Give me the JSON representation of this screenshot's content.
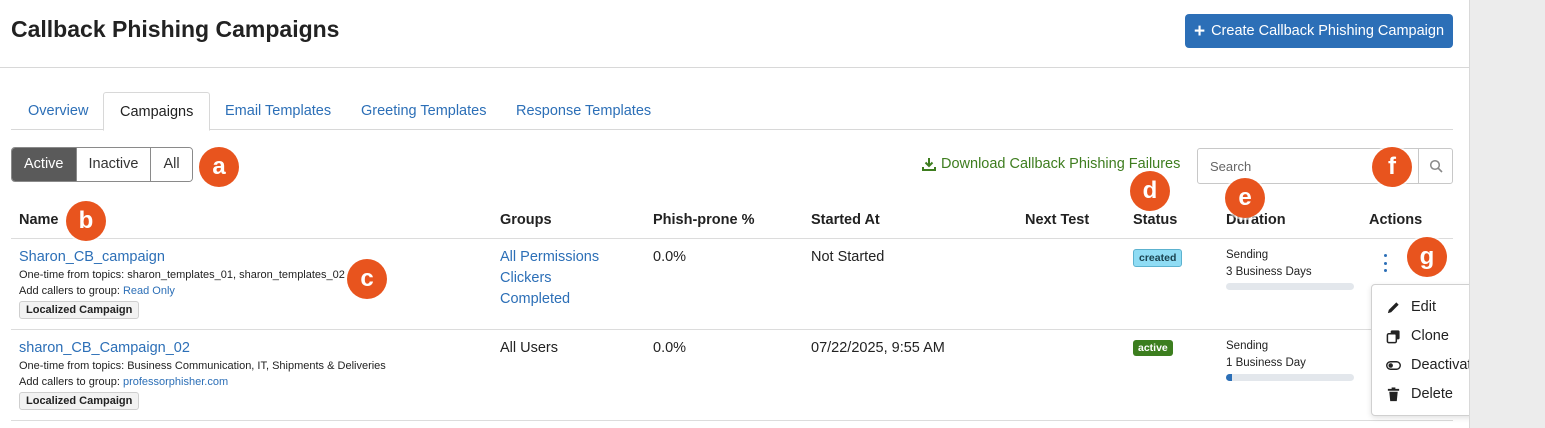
{
  "header": {
    "title": "Callback Phishing Campaigns",
    "create_button": "Create Callback Phishing Campaign"
  },
  "tabs": [
    "Overview",
    "Campaigns",
    "Email Templates",
    "Greeting Templates",
    "Response Templates"
  ],
  "filter": {
    "options": [
      "Active",
      "Inactive",
      "All"
    ],
    "selected": "Active"
  },
  "download_link": "Download Callback Phishing Failures",
  "search": {
    "placeholder": "Search"
  },
  "table": {
    "columns": [
      "Name",
      "Groups",
      "Phish-prone %",
      "Started At",
      "Next Test",
      "Status",
      "Duration",
      "Actions"
    ],
    "rows": [
      {
        "name": "Sharon_CB_campaign",
        "topics": "One-time from topics: sharon_templates_01, sharon_templates_02",
        "callers_prefix": "Add callers to group: ",
        "callers_group": "Read Only",
        "tag": "Localized Campaign",
        "groups": [
          "All Permissions",
          "Clickers",
          "Completed"
        ],
        "phish_prone": "0.0%",
        "started_at": "Not Started",
        "next_test": "",
        "status": "created",
        "duration_state": "Sending",
        "duration_length": "3 Business Days",
        "progress": 0
      },
      {
        "name": "sharon_CB_Campaign_02",
        "topics": "One-time from topics: Business Communication, IT, Shipments & Deliveries",
        "callers_prefix": "Add callers to group: ",
        "callers_group": "professorphisher.com",
        "tag": "Localized Campaign",
        "groups": [
          "All Users"
        ],
        "phish_prone": "0.0%",
        "started_at": "07/22/2025, 9:55 AM",
        "next_test": "",
        "status": "active",
        "duration_state": "Sending",
        "duration_length": "1 Business Day",
        "progress": 0.05
      }
    ]
  },
  "actions_menu": [
    "Edit",
    "Clone",
    "Deactivate",
    "Delete"
  ],
  "annotations": [
    "a",
    "b",
    "c",
    "d",
    "e",
    "f",
    "g"
  ],
  "colors": {
    "primary": "#2c6fb7",
    "badge": "#e8541e",
    "download_green": "#3e7d1f",
    "status_created": "#8fdcf4",
    "status_active": "#3c7e1f"
  }
}
